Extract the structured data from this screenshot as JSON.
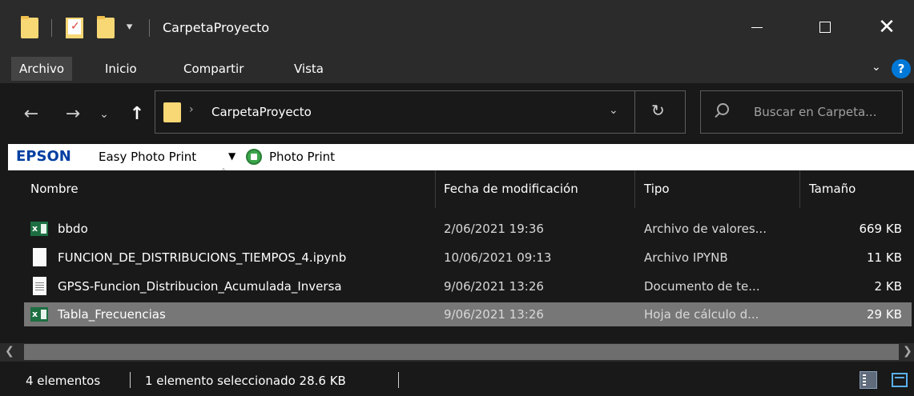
{
  "window": {
    "title": "CarpetaProyecto",
    "quick_access_arrow": "⯆",
    "minimize_icon": "minimize-icon",
    "maximize_icon": "maximize-icon",
    "close_glyph": "✕"
  },
  "ribbon": {
    "tabs": [
      {
        "label": "Archivo",
        "active": true
      },
      {
        "label": "Inicio",
        "active": false
      },
      {
        "label": "Compartir",
        "active": false
      },
      {
        "label": "Vista",
        "active": false
      }
    ],
    "expand_glyph": "⌄",
    "help_label": "?"
  },
  "navigation": {
    "back_glyph": "←",
    "forward_glyph": "→",
    "recent_glyph": "⌄",
    "up_glyph": "↑",
    "breadcrumb_sep": "›",
    "address_value": "CarpetaProyecto",
    "address_dropdown_glyph": "⌄",
    "refresh_glyph": "↻",
    "search_placeholder": "Buscar en Carpeta..."
  },
  "epson_toolbar": {
    "brand": "EPSON",
    "easy_photo_print": "Easy Photo Print",
    "dropdown_glyph": "▼",
    "photo_print": "Photo Print"
  },
  "columns": {
    "name": "Nombre",
    "modified": "Fecha de modificación",
    "type": "Tipo",
    "size": "Tamaño",
    "sort_caret": "˄"
  },
  "files": [
    {
      "name": "bbdo",
      "modified": "2/06/2021 19:36",
      "type": "Archivo de valores...",
      "size": "669 KB",
      "icon": "excel-csv-icon",
      "selected": false
    },
    {
      "name": "FUNCION_DE_DISTRIBUCIONS_TIEMPOS_4.ipynb",
      "modified": "10/06/2021 09:13",
      "type": "Archivo IPYNB",
      "size": "11 KB",
      "icon": "blank-file-icon",
      "selected": false
    },
    {
      "name": "GPSS-Funcion_Distribucion_Acumulada_Inversa",
      "modified": "9/06/2021 13:26",
      "type": "Documento de te...",
      "size": "2 KB",
      "icon": "text-document-icon",
      "selected": false
    },
    {
      "name": "Tabla_Frecuencias",
      "modified": "9/06/2021 13:26",
      "type": "Hoja de cálculo d...",
      "size": "29 KB",
      "icon": "excel-sheet-icon",
      "selected": true
    }
  ],
  "scrollbar": {
    "left_glyph": "❮",
    "right_glyph": "❯"
  },
  "status_bar": {
    "item_count": "4 elementos",
    "selection": "1 elemento seleccionado  28.6 KB"
  },
  "colors": {
    "background": "#191919",
    "title_bar": "#2b2b2b",
    "selected_row": "#777777",
    "folder": "#f8d775",
    "epson_blue": "#003ea1",
    "help_blue": "#0078d7"
  }
}
